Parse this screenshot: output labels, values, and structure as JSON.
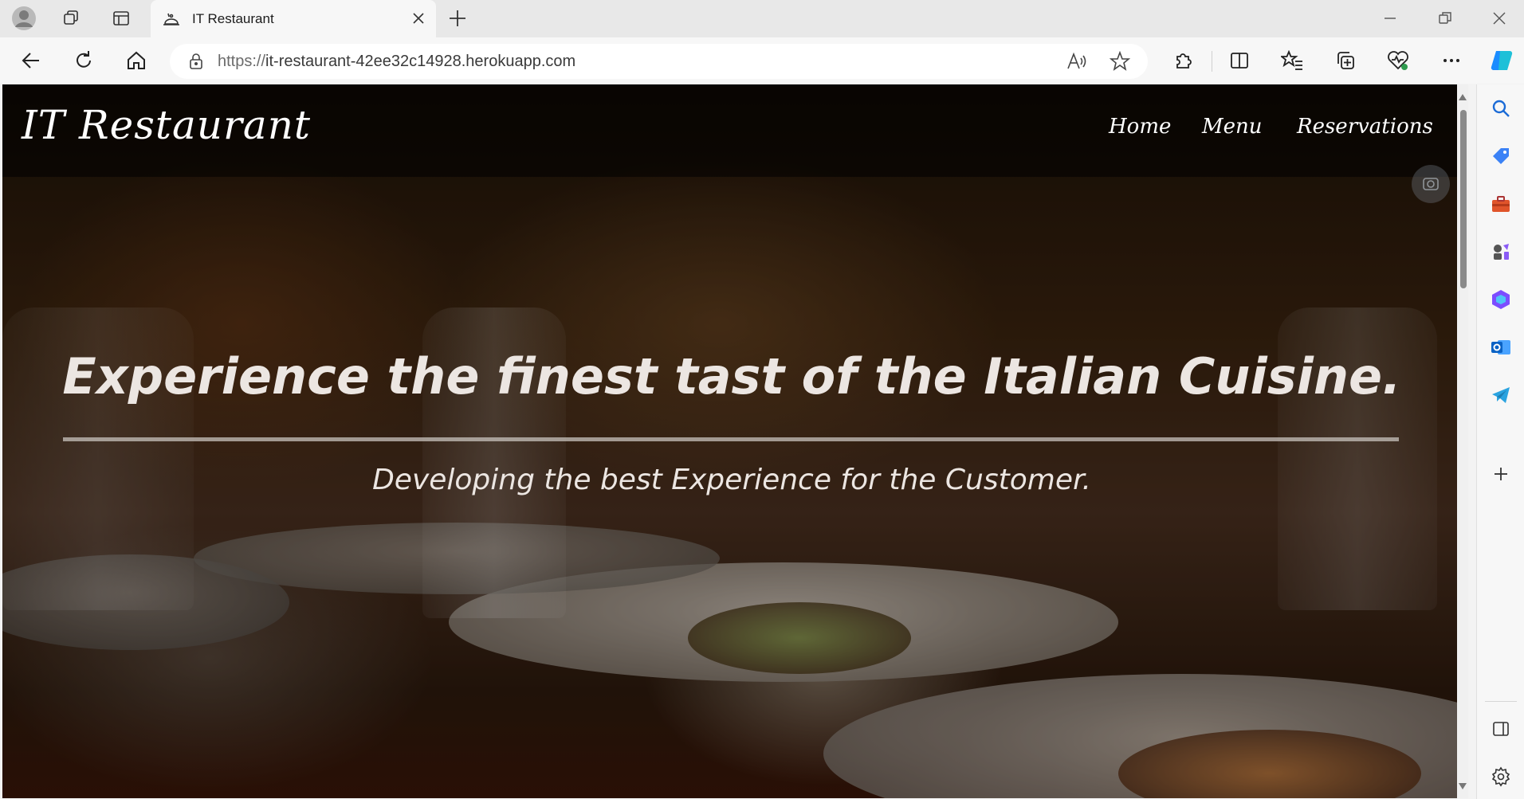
{
  "browser": {
    "tab_title": "IT Restaurant",
    "url_protocol": "https://",
    "url_host": "it-restaurant-42ee32c14928.herokuapp.com"
  },
  "site": {
    "brand": "IT Restaurant",
    "nav": [
      {
        "label": "Home"
      },
      {
        "label": "Menu"
      },
      {
        "label": "Reservations"
      }
    ],
    "hero_title": "Experience the finest tast of the Italian Cuisine.",
    "hero_subtitle": "Developing the best Experience for the Customer."
  },
  "colors": {
    "hero_text": "#ece6e2",
    "header_overlay": "rgba(0,0,0,0.55)"
  },
  "icons": {
    "toolbar": [
      "back-icon",
      "refresh-icon",
      "home-icon",
      "lock-icon",
      "read-aloud-icon",
      "favorite-star-icon",
      "extensions-icon",
      "split-screen-icon",
      "favorites-icon",
      "collections-icon",
      "browser-essentials-icon",
      "more-icon",
      "copilot-icon"
    ],
    "sidebar": [
      "search-icon",
      "shopping-icon",
      "tools-icon",
      "games-icon",
      "microsoft-365-icon",
      "outlook-icon",
      "telegram-icon",
      "add-icon",
      "sidebar-toggle-icon",
      "settings-icon"
    ]
  }
}
